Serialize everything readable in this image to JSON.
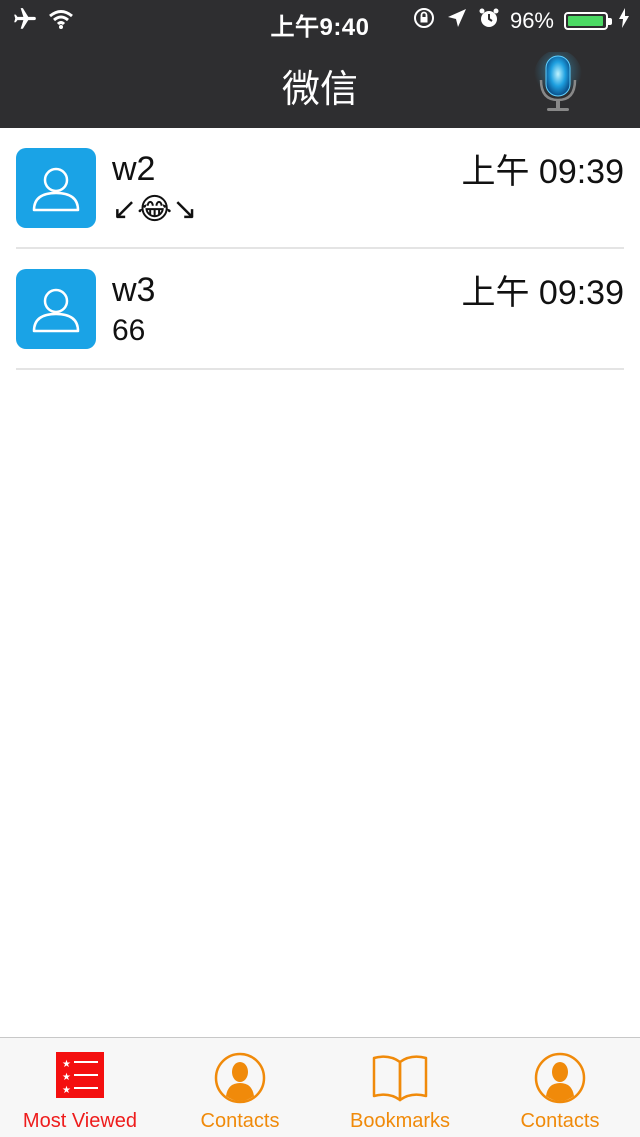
{
  "status_bar": {
    "time": "上午9:40",
    "battery_percent": "96%",
    "battery_level": 0.96,
    "battery_color": "#4cd964"
  },
  "navbar": {
    "title": "微信",
    "right_icon": "microphone-icon"
  },
  "conversations": [
    {
      "name": "w2",
      "message": "↙😂↘",
      "time": "上午 09:39",
      "avatar_icon": "person-icon",
      "avatar_color": "#1aa3e6"
    },
    {
      "name": "w3",
      "message": "66",
      "time": "上午 09:39",
      "avatar_icon": "person-icon",
      "avatar_color": "#1aa3e6"
    }
  ],
  "tabbar": {
    "accent_color": "#f08a0a",
    "active_color": "#ee1c1c",
    "items": [
      {
        "label": "Most Viewed",
        "icon": "most-viewed-list-icon",
        "active": true
      },
      {
        "label": "Contacts",
        "icon": "contact-person-icon",
        "active": false
      },
      {
        "label": "Bookmarks",
        "icon": "open-book-icon",
        "active": false
      },
      {
        "label": "Contacts",
        "icon": "contact-person-icon",
        "active": false
      }
    ]
  }
}
